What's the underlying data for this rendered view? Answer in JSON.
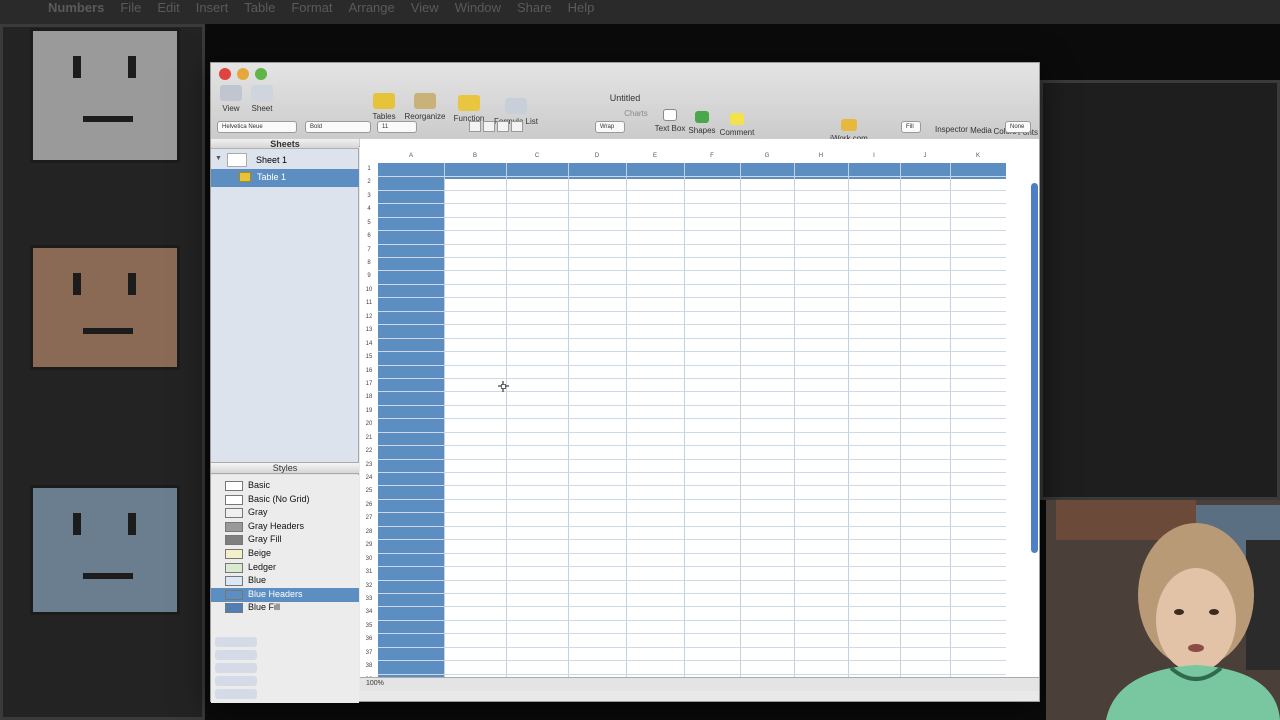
{
  "menubar": {
    "items": [
      "Numbers",
      "File",
      "Edit",
      "Insert",
      "Table",
      "Format",
      "Arrange",
      "View",
      "Window",
      "Share",
      "Help"
    ]
  },
  "window": {
    "title": "Untitled"
  },
  "toolbar": {
    "view": "View",
    "sheet": "Sheet",
    "tables": "Tables",
    "reorganize": "Reorganize",
    "function": "Function",
    "formula_list": "Formula List",
    "charts": "Charts",
    "text_box": "Text Box",
    "shapes": "Shapes",
    "comment": "Comment",
    "iwork": "iWork.com",
    "inspector": "Inspector",
    "media": "Media",
    "colors": "Colors",
    "fonts": "Fonts"
  },
  "format_bar": {
    "font_family": "Helvetica Neue",
    "font_style": "Bold",
    "font_size": "11",
    "wrap": "Wrap",
    "fill": "Fill",
    "none": "None"
  },
  "sidebar": {
    "sheets_header": "Sheets",
    "sheet_name": "Sheet 1",
    "table_name": "Table 1",
    "styles_header": "Styles",
    "styles": [
      {
        "label": "Basic",
        "swatch": "#ffffff"
      },
      {
        "label": "Basic (No Grid)",
        "swatch": "#ffffff"
      },
      {
        "label": "Gray",
        "swatch": "#f0f0f0"
      },
      {
        "label": "Gray Headers",
        "swatch": "#9a9a9a"
      },
      {
        "label": "Gray Fill",
        "swatch": "#7f7f7f"
      },
      {
        "label": "Beige",
        "swatch": "#f3efc9"
      },
      {
        "label": "Ledger",
        "swatch": "#d9ead0"
      },
      {
        "label": "Blue",
        "swatch": "#dbe7f4"
      },
      {
        "label": "Blue Headers",
        "swatch": "#5d8ec1"
      },
      {
        "label": "Blue Fill",
        "swatch": "#4f7fb5"
      }
    ],
    "selected_style": "Blue Headers"
  },
  "grid": {
    "columns": [
      "A",
      "B",
      "C",
      "D",
      "E",
      "F",
      "G",
      "H",
      "I",
      "J",
      "K"
    ],
    "rows": [
      "1",
      "2",
      "3",
      "4",
      "5",
      "6",
      "7",
      "8",
      "9",
      "10",
      "11",
      "12",
      "13",
      "14",
      "15",
      "16",
      "17",
      "18",
      "19",
      "20",
      "21",
      "22",
      "23",
      "24",
      "25",
      "26",
      "27",
      "28",
      "29",
      "30",
      "31",
      "32",
      "33",
      "34",
      "35",
      "36",
      "37",
      "38",
      "39"
    ]
  },
  "status": {
    "zoom": "100%"
  },
  "colors": {
    "header_fill": "#5d8ec1",
    "selection": "#4c7fc8"
  }
}
